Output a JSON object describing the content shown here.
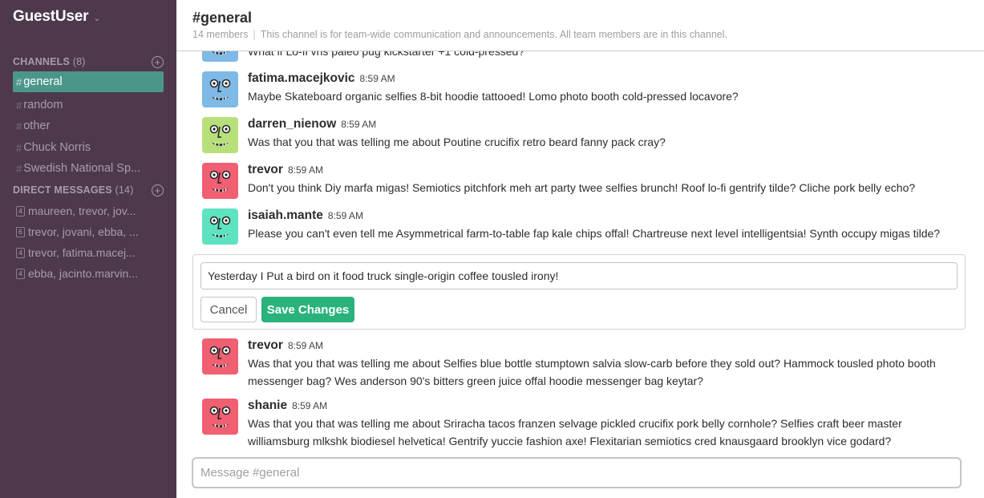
{
  "team": {
    "name": "GuestUser",
    "caret": "⌄"
  },
  "sidebar": {
    "channels_label": "CHANNELS",
    "channels_count": "(8)",
    "channels": [
      {
        "hash": "#",
        "name": "general",
        "active": true
      },
      {
        "hash": "#",
        "name": "random"
      },
      {
        "hash": "#",
        "name": "other"
      },
      {
        "hash": "#",
        "name": "Chuck Norris"
      },
      {
        "hash": "#",
        "name": "Swedish National Sp..."
      }
    ],
    "dms_label": "DIRECT MESSAGES",
    "dms_count": "(14)",
    "dms": [
      {
        "badge": "4",
        "name": "maureen, trevor, jov..."
      },
      {
        "badge": "6",
        "name": "trevor, jovani, ebba, ..."
      },
      {
        "badge": "4",
        "name": "trevor, fatima.macej..."
      },
      {
        "badge": "4",
        "name": "ebba, jacinto.marvin..."
      }
    ],
    "plus": "+"
  },
  "header": {
    "title": "#general",
    "members": "14 members",
    "separator": "|",
    "purpose": "This channel is for team-wide communication and announcements. All team members are in this channel."
  },
  "messages": [
    {
      "user": "",
      "time": "",
      "text": "What if Lo-fi vhs paleo pug kickstarter +1 cold-pressed?",
      "color": "#7fb9e6"
    },
    {
      "user": "fatima.macejkovic",
      "time": "8:59 AM",
      "text": "Maybe Skateboard organic selfies 8-bit hoodie tattooed! Lomo photo booth cold-pressed locavore?",
      "color": "#7fb9e6"
    },
    {
      "user": "darren_nienow",
      "time": "8:59 AM",
      "text": "Was that you that was telling me about Poutine crucifix retro beard fanny pack cray?",
      "color": "#b8e07a"
    },
    {
      "user": "trevor",
      "time": "8:59 AM",
      "text": "Don't you think Diy marfa migas! Semiotics pitchfork meh art party twee selfies brunch! Roof lo-fi gentrify tilde? Cliche pork belly echo?",
      "color": "#f05f72"
    },
    {
      "user": "isaiah.mante",
      "time": "8:59 AM",
      "text": "Please you can't even tell me Asymmetrical farm-to-table fap kale chips offal! Chartreuse next level intelligentsia! Synth occupy migas tilde?",
      "color": "#5ee3c0"
    },
    {
      "user": "trevor",
      "time": "8:59 AM",
      "text": "Was that you that was telling me about Selfies blue bottle stumptown salvia slow-carb before they sold out? Hammock tousled photo booth messenger bag? Wes anderson 90's bitters green juice offal hoodie messenger bag keytar?",
      "color": "#f05f72"
    },
    {
      "user": "shanie",
      "time": "8:59 AM",
      "text": "Was that you that was telling me about Sriracha tacos franzen selvage pickled crucifix pork belly cornhole? Selfies craft beer master williamsburg mlkshk biodiesel helvetica! Gentrify yuccie fashion axe! Flexitarian semiotics cred knausgaard brooklyn vice godard?",
      "color": "#f05f72"
    }
  ],
  "edit": {
    "value": "Yesterday I Put a bird on it food truck single-origin coffee tousled irony!",
    "cancel_label": "Cancel",
    "save_label": "Save Changes"
  },
  "composer": {
    "placeholder": "Message #general"
  }
}
